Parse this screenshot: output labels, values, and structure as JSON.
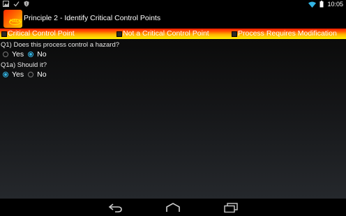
{
  "status_bar": {
    "left_icons": [
      "image-icon",
      "check-icon",
      "shield-icon"
    ],
    "right_icons": [
      "wifi-icon",
      "battery-icon"
    ],
    "time": "10:05"
  },
  "action_bar": {
    "app_icon": "haccp-app-icon",
    "app_icon_badge": "HACCP",
    "title": "Principle 2 - Identify Critical Control Points"
  },
  "category_bar": {
    "options": [
      {
        "label": "Critical Control Point",
        "checked": false
      },
      {
        "label": "Not a Critical Control Point",
        "checked": false
      },
      {
        "label": "Process Requires Modification",
        "checked": false
      }
    ]
  },
  "questions": [
    {
      "text": "Q1) Does this process control a hazard?",
      "options": [
        {
          "label": "Yes",
          "selected": false
        },
        {
          "label": "No",
          "selected": true
        }
      ]
    },
    {
      "text": "Q1a) Should it?",
      "options": [
        {
          "label": "Yes",
          "selected": true
        },
        {
          "label": "No",
          "selected": false
        }
      ]
    }
  ],
  "nav_bar": {
    "buttons": [
      "back-icon",
      "home-icon",
      "recent-apps-icon"
    ]
  },
  "colors": {
    "accent": "#33b5e5",
    "gradient_top": "#ff1a00",
    "gradient_bottom": "#fff000"
  }
}
